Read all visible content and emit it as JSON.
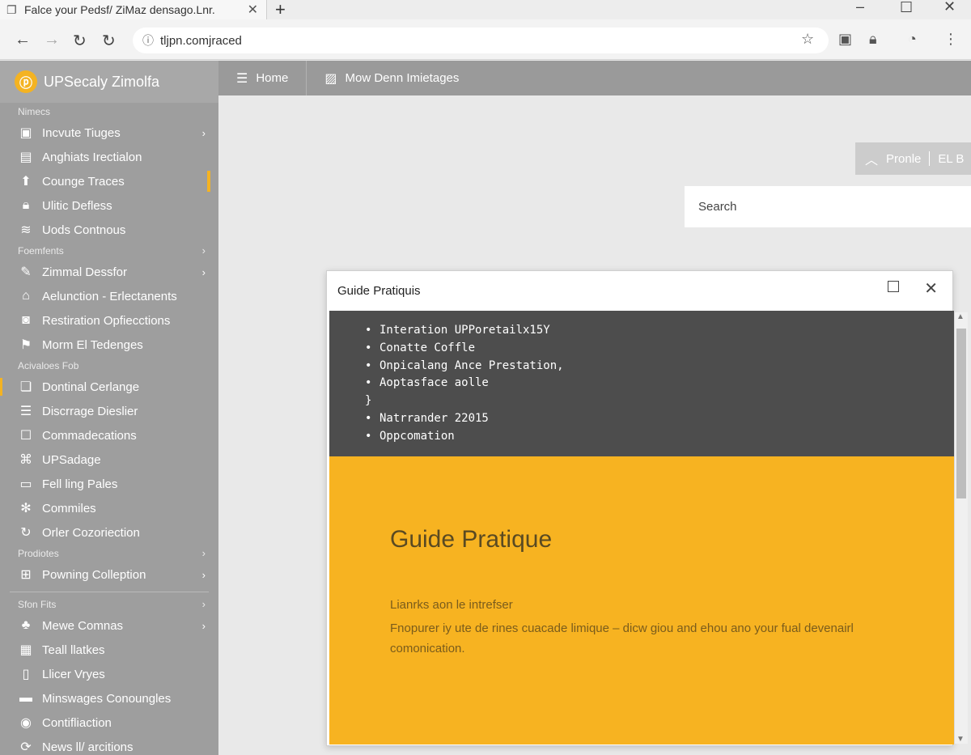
{
  "browser": {
    "tab_title": "Falce your Pedsf/ ZiMaz densago.Lnr.",
    "tab_favicon": "document-icon",
    "url": "tljpn.comjraced"
  },
  "sidebar": {
    "app_name": "UPSecaly Zimolfa",
    "sections": [
      {
        "label": "Nimecs",
        "items": [
          {
            "label": "Incvute Tiuges",
            "icon": "image-icon",
            "chevron": true
          },
          {
            "label": "Anghiats Irectialon",
            "icon": "grid-icon"
          },
          {
            "label": "Counge Traces",
            "icon": "upload-icon",
            "active": true
          },
          {
            "label": "Ulitic Defless",
            "icon": "lock-icon"
          },
          {
            "label": "Uods Contnous",
            "icon": "wifi-icon"
          }
        ]
      },
      {
        "label": "Foemfents",
        "chevron": true,
        "items": [
          {
            "label": "Zimmal Dessfor",
            "icon": "chat-icon",
            "chevron": true
          },
          {
            "label": "Aelunction - Erlectanents",
            "icon": "home-icon"
          },
          {
            "label": "Restiration Opfiecctions",
            "icon": "users-icon"
          },
          {
            "label": "Morm El Tedenges",
            "icon": "flag-icon"
          }
        ]
      },
      {
        "label": "Acivaloes Fob",
        "items": [
          {
            "label": "Dontinal Cerlange",
            "icon": "clipboard-icon",
            "marked": true
          },
          {
            "label": "Discrrage Dieslier",
            "icon": "layers-icon"
          },
          {
            "label": "Commadecations",
            "icon": "square-icon"
          },
          {
            "label": "UPSadage",
            "icon": "code-icon"
          },
          {
            "label": "Fell ling Pales",
            "icon": "doc-icon"
          },
          {
            "label": "Commiles",
            "icon": "puzzle-icon"
          },
          {
            "label": "Orler Cozoriection",
            "icon": "cycle-icon"
          }
        ]
      },
      {
        "label": "Prodiotes",
        "chevron": true,
        "items": [
          {
            "label": "Powning Colleption",
            "icon": "network-icon",
            "chevron": true
          }
        ]
      },
      {
        "label": "Sfon Fits",
        "chevron": true,
        "divider": true,
        "items": [
          {
            "label": "Mewe Comnas",
            "icon": "tree-icon",
            "chevron": true
          },
          {
            "label": "Teall llatkes",
            "icon": "table-icon"
          },
          {
            "label": "Llicer Vryes",
            "icon": "page-icon"
          },
          {
            "label": "Minswages Conoungles",
            "icon": "monitor-icon"
          },
          {
            "label": "Contifliaction",
            "icon": "globe-icon"
          },
          {
            "label": "News ll/ arcitions",
            "icon": "refresh-icon"
          }
        ]
      }
    ]
  },
  "appbar": {
    "items": [
      {
        "label": "Home",
        "icon": "menu-icon"
      },
      {
        "label": "Mow Denn Imietages",
        "icon": "gallery-icon"
      }
    ]
  },
  "pill": {
    "label": "Pronle",
    "suffix": "EL B"
  },
  "search": {
    "placeholder": "Search"
  },
  "dialog": {
    "title": "Guide Pratiquis",
    "code_lines": [
      {
        "bullet": "•",
        "text": "Interation UPPoretailx15Y"
      },
      {
        "bullet": "•",
        "text": "Conatte Coffle"
      },
      {
        "bullet": "•",
        "text": "Onpicalang Ance Prestation,"
      },
      {
        "bullet": "•",
        "text": "Aoptasface aolle"
      },
      {
        "bullet": "}",
        "text": ""
      },
      {
        "bullet": "•",
        "text": "Natrrander 22015"
      },
      {
        "bullet": "•",
        "text": "Oppcomation"
      }
    ],
    "hero_title": "Guide Pratique",
    "hero_subtitle": "Lianrks aon le intrefser",
    "hero_body": "Fnopurer iy ute de rines cuacade limique – dicw giou and ehou ano your fual devenairl comonication."
  },
  "colors": {
    "accent": "#f7b321",
    "sidebar_bg": "#9e9e9e",
    "code_bg": "#4d4d4d"
  }
}
